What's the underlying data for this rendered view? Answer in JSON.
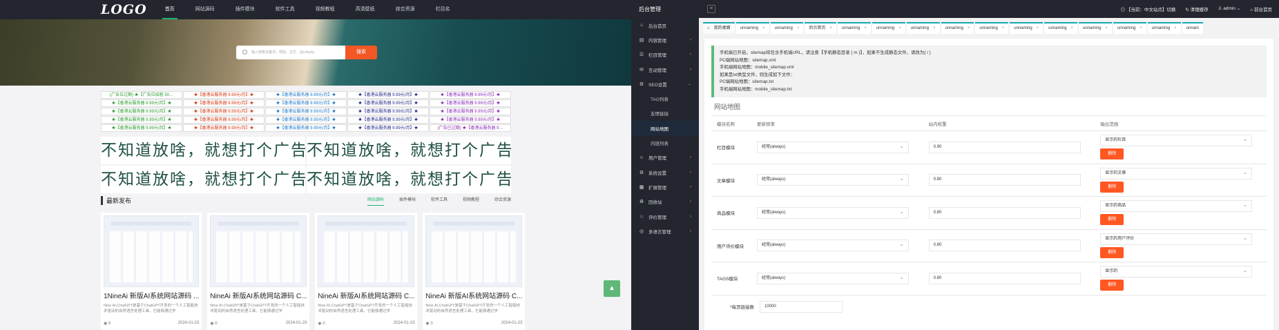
{
  "site": {
    "logo": "LOGO",
    "nav": [
      "首页",
      "网站源码",
      "插件模块",
      "软件工具",
      "视频教程",
      "高清壁纸",
      "综合资源",
      "栏目名"
    ],
    "search": {
      "placeholder": "输入搜索关键词，例如、主打、@csbphp",
      "button": "搜索"
    },
    "ads": [
      "(广告位过期) ★【广告位招租 50…",
      "★【香港云服务器 9.99元/月】★",
      "★【香港云服务器 9.99元/月】★",
      "★【香港云服务器 9.99元/月】★",
      "★【香港云服务器 9.99元/月】★",
      "★【香港云服务器 9.99元/月】★",
      "★【香港云服务器 9.99元/月】★",
      "★【香港云服务器 9.99元/月】★",
      "★【香港云服务器 9.99元/月】★",
      "★【香港云服务器 9.99元/月】★",
      "★【香港云服务器 9.99元/月】★",
      "★【香港云服务器 9.99元/月】★",
      "★【香港云服务器 9.99元/月】★",
      "★【香港云服务器 9.99元/月】★",
      "★【香港云服务器 9.99元/月】★",
      "★【香港云服务器 9.99元/月】★",
      "★【香港云服务器 9.99元/月】★",
      "★【香港云服务器 9.99元/月】★",
      "★【香港云服务器 9.99元/月】★",
      "★【香港云服务器 9.99元/月】★",
      "★【香港云服务器 9.99元/月】★",
      "★【香港云服务器 9.99元/月】★",
      "★【香港云服务器 9.99元/月】★",
      "★【香港云服务器 9.99元/月】★",
      "(广告已过期) ★【香港云服务器 9…"
    ],
    "ad_colors": [
      "#2a9c2a",
      "#d9360f",
      "#1a77c9",
      "#222a8a",
      "#8b2bb8"
    ],
    "banner_text": "不知道放啥，就想打个广告",
    "section_title": "最新发布",
    "tabs": [
      "网站源码",
      "插件模块",
      "软件工具",
      "视频教程",
      "综合资源"
    ],
    "cards": [
      {
        "title": "1NineAi 新版AI系统网站源码 ...",
        "desc": "Nine AI.ChatGPT是基于ChatGPT开发的一个人工智能技术驱动的自然语言处理工具，它能够通过学",
        "views": "0",
        "date": "2024-01-23"
      },
      {
        "title": "NineAi 新版AI系统网站源码 C...",
        "desc": "Nine AI.ChatGPT是基于ChatGPT开发的一个人工智能技术驱动的自然语言处理工具，它能够通过学",
        "views": "0",
        "date": "2024-01-23"
      },
      {
        "title": "NineAi 新版AI系统网站源码 C...",
        "desc": "Nine AI.ChatGPT是基于ChatGPT开发的一个人工智能技术驱动的自然语言处理工具，它能够通过学",
        "views": "0",
        "date": "2024-01-23"
      },
      {
        "title": "NineAi 新版AI系统网站源码 C...",
        "desc": "Nine AI.ChatGPT是基于ChatGPT开发的一个人工智能技术驱动的自然语言处理工具，它能够通过学",
        "views": "0",
        "date": "2024-01-23"
      }
    ]
  },
  "admin": {
    "title": "后台管理",
    "top": {
      "lang": "【当前：中文站点】切换",
      "clear": "清理缓存",
      "user": "admin",
      "home": "前台首页"
    },
    "menu": [
      {
        "label": "后台首页",
        "icon": "⌂",
        "arrow": ""
      },
      {
        "label": "内容管理",
        "icon": "▤",
        "arrow": "›"
      },
      {
        "label": "栏目管理",
        "icon": "☰",
        "arrow": "›"
      },
      {
        "label": "互动管理",
        "icon": "✉",
        "arrow": "›"
      },
      {
        "label": "SEO设置",
        "icon": "⚙",
        "arrow": "⌄"
      },
      {
        "label": "TAG列表",
        "icon": "",
        "arrow": "",
        "sub": true
      },
      {
        "label": "友情链接",
        "icon": "",
        "arrow": "",
        "sub": true
      },
      {
        "label": "网站地图",
        "icon": "",
        "arrow": "",
        "sub": true,
        "on": true
      },
      {
        "label": "内链列表",
        "icon": "",
        "arrow": "",
        "sub": true
      },
      {
        "label": "用户管理",
        "icon": "☺",
        "arrow": "›"
      },
      {
        "label": "系统设置",
        "icon": "⚙",
        "arrow": "›"
      },
      {
        "label": "扩展管理",
        "icon": "▦",
        "arrow": "›"
      },
      {
        "label": "回收站",
        "icon": "♻",
        "arrow": "›"
      },
      {
        "label": "评价管理",
        "icon": "☆",
        "arrow": "›"
      },
      {
        "label": "多语言管理",
        "icon": "◎",
        "arrow": "›"
      }
    ],
    "tabs": [
      "我的桌面",
      "unnaming",
      "unnaming",
      "后台首页",
      "unnaming",
      "unnaming",
      "unnaming",
      "unnaming",
      "unnaming",
      "unnaming",
      "unnaming",
      "unnaming",
      "unnaming",
      "unnaming",
      "unnam"
    ],
    "notice": [
      "手机端已开启，sitemap将包含手机端URL，请注意【手机静态目录 { m }】，如果不生成静态文件，请改为{ / }",
      "PC端网站地图：sitemap.xml",
      "手机端网站地图：mobile_sitemap.xml",
      "如果是txt类型文件，则生成如下文件：",
      "PC端网站地图：sitemap.txt",
      "手机端网站地图：mobile_sitemap.txt"
    ],
    "panel_title": "网站地图",
    "columns": [
      "模块名称",
      "更新频率",
      "站内权重",
      "输出范围"
    ],
    "rows": [
      {
        "name": "栏目模块",
        "freq": "经常(always)",
        "weight": "0.90",
        "range": "显示的栏目",
        "del": "删除"
      },
      {
        "name": "文章模块",
        "freq": "经常(always)",
        "weight": "0.80",
        "range": "显示的文章",
        "del": "删除"
      },
      {
        "name": "商品模块",
        "freq": "经常(always)",
        "weight": "0.80",
        "range": "显示的商品",
        "del": "删除"
      },
      {
        "name": "用户评价模块",
        "freq": "经常(always)",
        "weight": "0.80",
        "range": "显示的用户评价",
        "del": "删除"
      },
      {
        "name": "TAGS模块",
        "freq": "经常(always)",
        "weight": "0.80",
        "range": "显示的",
        "del": "删除"
      }
    ],
    "per_page": {
      "label": "*每页链接数",
      "value": "10000"
    }
  }
}
